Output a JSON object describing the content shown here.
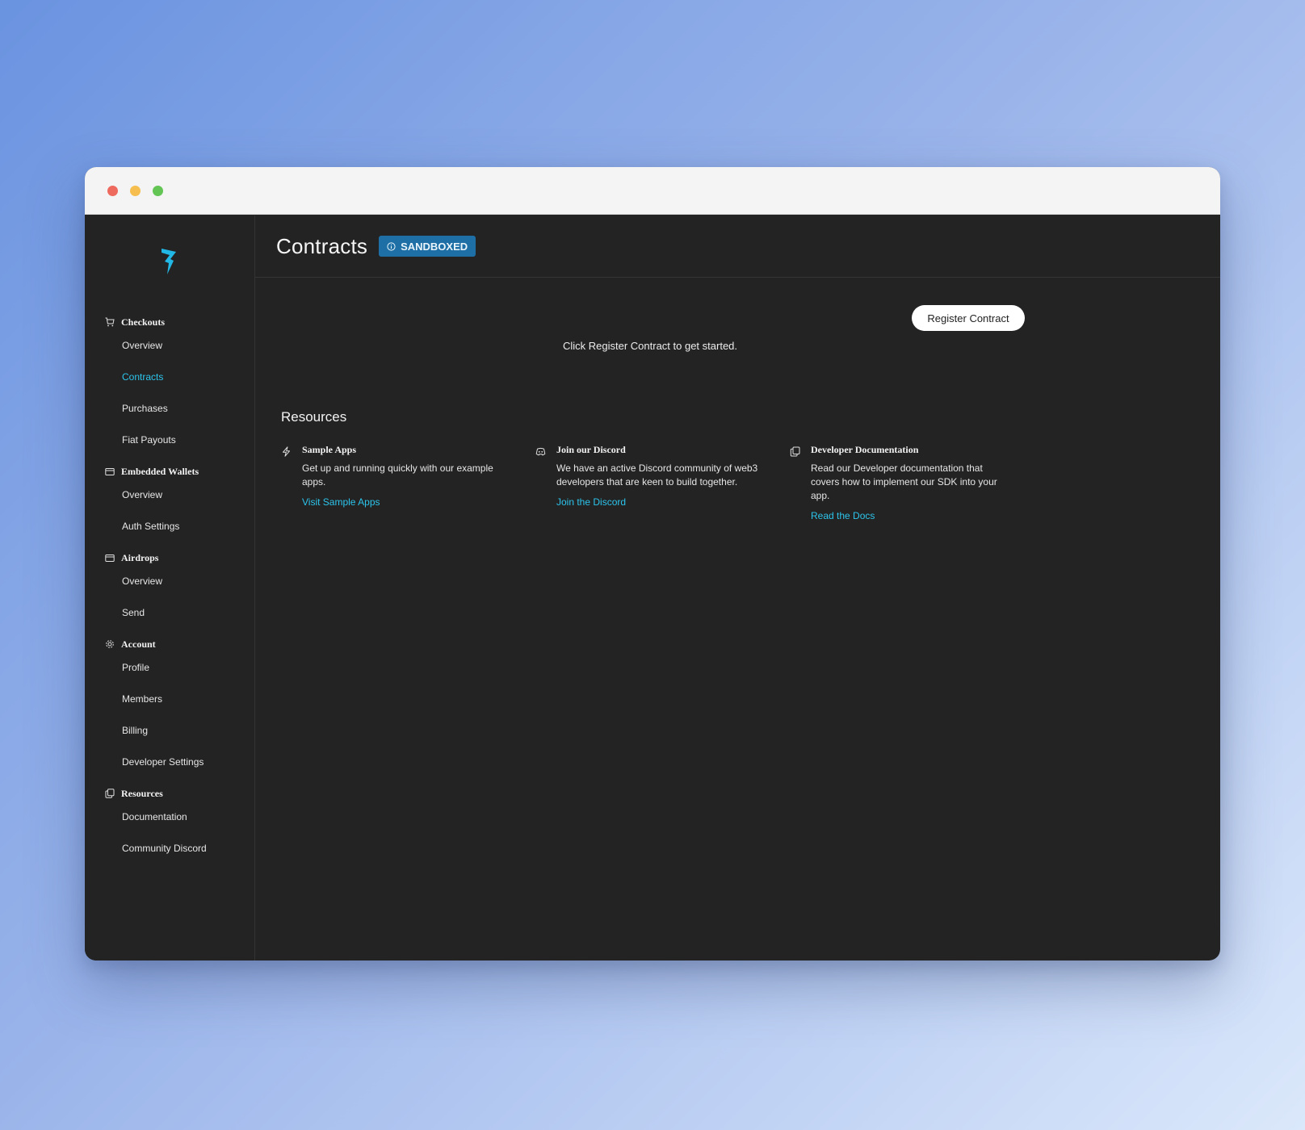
{
  "window": {
    "controls": [
      "close",
      "minimize",
      "maximize"
    ]
  },
  "sidebar": {
    "sections": [
      {
        "label": "Checkouts",
        "icon": "cart-icon",
        "items": [
          {
            "label": "Overview",
            "active": false
          },
          {
            "label": "Contracts",
            "active": true
          },
          {
            "label": "Purchases",
            "active": false
          },
          {
            "label": "Fiat Payouts",
            "active": false
          }
        ]
      },
      {
        "label": "Embedded Wallets",
        "icon": "wallet-icon",
        "items": [
          {
            "label": "Overview",
            "active": false
          },
          {
            "label": "Auth Settings",
            "active": false
          }
        ]
      },
      {
        "label": "Airdrops",
        "icon": "box-icon",
        "items": [
          {
            "label": "Overview",
            "active": false
          },
          {
            "label": "Send",
            "active": false
          }
        ]
      },
      {
        "label": "Account",
        "icon": "gear-icon",
        "items": [
          {
            "label": "Profile",
            "active": false
          },
          {
            "label": "Members",
            "active": false
          },
          {
            "label": "Billing",
            "active": false
          },
          {
            "label": "Developer Settings",
            "active": false
          }
        ]
      },
      {
        "label": "Resources",
        "icon": "copy-icon",
        "items": [
          {
            "label": "Documentation",
            "active": false
          },
          {
            "label": "Community Discord",
            "active": false
          }
        ]
      }
    ]
  },
  "header": {
    "title": "Contracts",
    "badge": "SANDBOXED"
  },
  "main": {
    "register_button": "Register Contract",
    "empty_message": "Click Register Contract to get started.",
    "resources_title": "Resources",
    "cards": [
      {
        "title": "Sample Apps",
        "icon": "bolt-icon",
        "description": "Get up and running quickly with our example apps.",
        "link": "Visit Sample Apps"
      },
      {
        "title": "Join our Discord",
        "icon": "discord-icon",
        "description": "We have an active Discord community of web3 developers that are keen to build together.",
        "link": "Join the Discord"
      },
      {
        "title": "Developer Documentation",
        "icon": "copy-icon",
        "description": "Read our Developer documentation that covers how to implement our SDK into your app.",
        "link": "Read the Docs"
      }
    ]
  },
  "colors": {
    "accent": "#2cc4ec",
    "badge": "#1d6fa5",
    "background": "#232323"
  }
}
